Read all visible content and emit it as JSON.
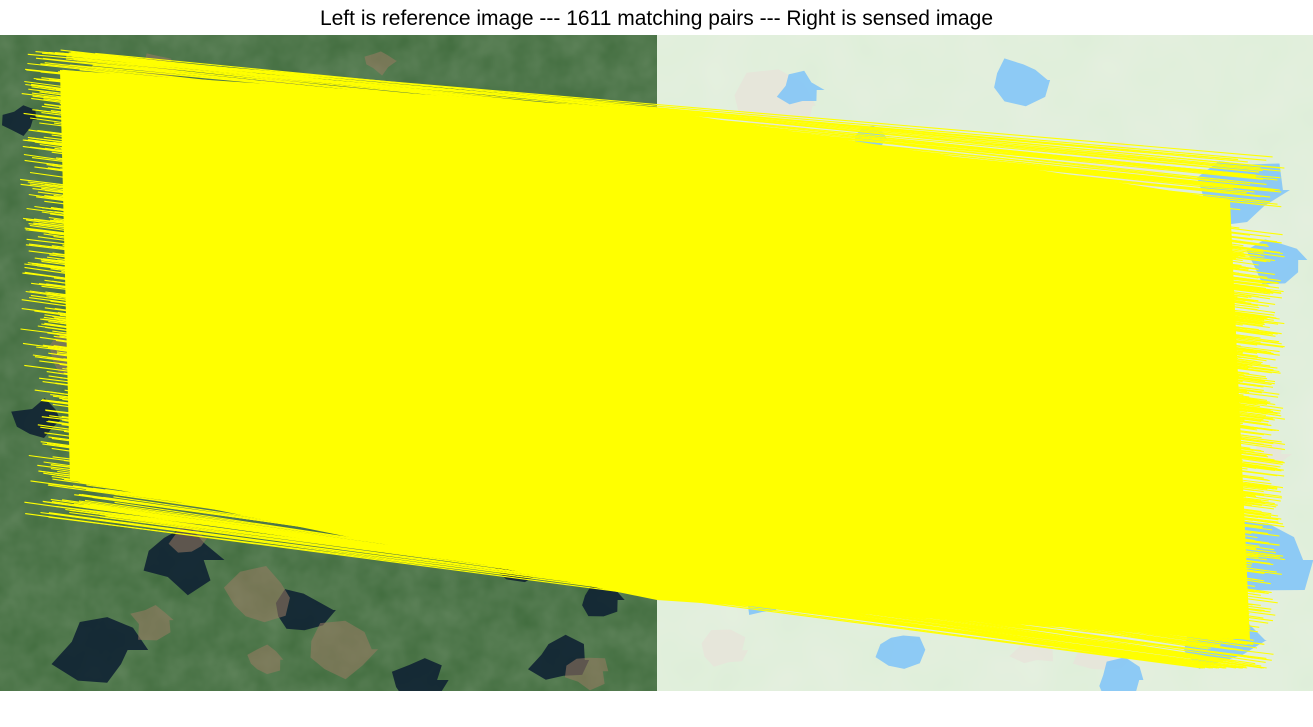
{
  "figure": {
    "title": "Left is reference image --- 1611 matching pairs --- Right is sensed image"
  },
  "images": {
    "reference": {
      "kind": "satellite-photo",
      "base_color": "#3f6b3c",
      "lake_color": "#0f2233",
      "clearing_color": "#9a7a63"
    },
    "sensed": {
      "kind": "map-tile",
      "base_color": "#ddeed8",
      "water_color": "#88c7f5",
      "rock_color": "#e7e3da"
    }
  },
  "matches": {
    "count": 1611,
    "line_color": "#ffff00"
  }
}
